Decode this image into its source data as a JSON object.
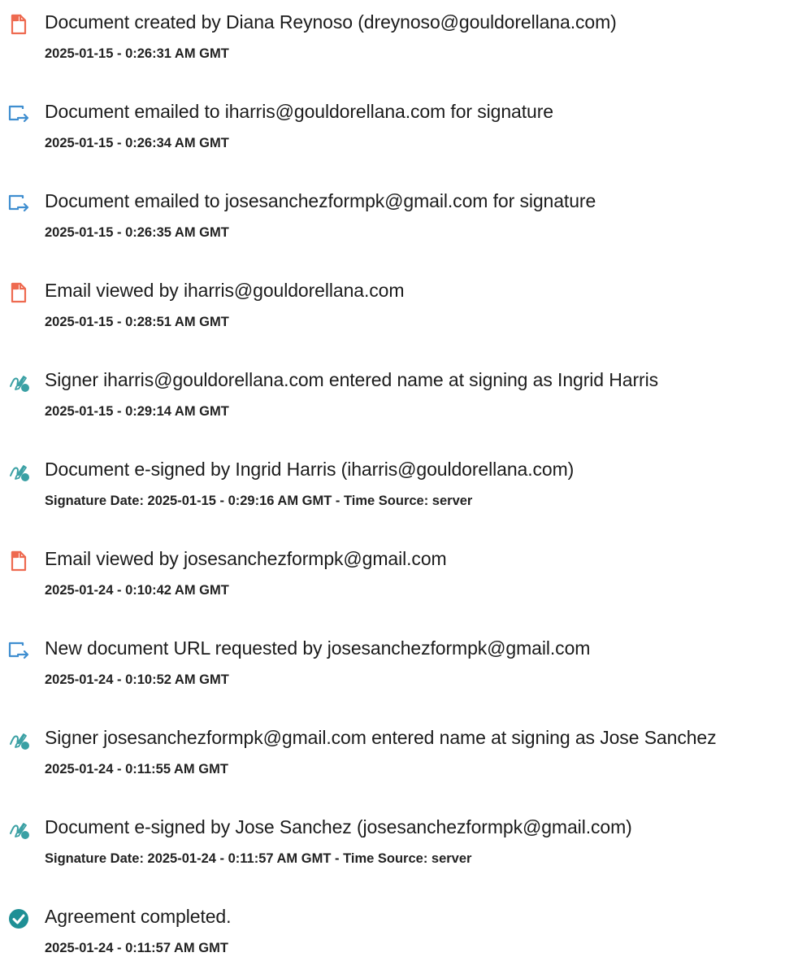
{
  "colors": {
    "doc_icon": "#ee6a50",
    "email_icon": "#3f8ed0",
    "sign_icon": "#3aa0a4",
    "complete_icon": "#1e8f95",
    "text": "#1c1c1c"
  },
  "events": [
    {
      "icon": "document-icon",
      "text": "Document created by Diana Reynoso (dreynoso@gouldorellana.com)",
      "time": "2025-01-15 - 0:26:31 AM GMT"
    },
    {
      "icon": "email-sent-icon",
      "text": "Document emailed to iharris@gouldorellana.com for signature",
      "time": "2025-01-15 - 0:26:34 AM GMT"
    },
    {
      "icon": "email-sent-icon",
      "text": "Document emailed to josesanchezformpk@gmail.com for signature",
      "time": "2025-01-15 - 0:26:35 AM GMT"
    },
    {
      "icon": "document-icon",
      "text": "Email viewed by iharris@gouldorellana.com",
      "time": "2025-01-15 - 0:28:51 AM GMT"
    },
    {
      "icon": "signature-pen-icon",
      "text": "Signer iharris@gouldorellana.com entered name at signing as Ingrid Harris",
      "time": "2025-01-15 - 0:29:14 AM GMT"
    },
    {
      "icon": "signature-pen-icon",
      "text": "Document e-signed by Ingrid Harris (iharris@gouldorellana.com)",
      "time": "Signature Date: 2025-01-15 - 0:29:16 AM GMT - Time Source: server"
    },
    {
      "icon": "document-icon",
      "text": "Email viewed by josesanchezformpk@gmail.com",
      "time": "2025-01-24 - 0:10:42 AM GMT"
    },
    {
      "icon": "email-sent-icon",
      "text": "New document URL requested by josesanchezformpk@gmail.com",
      "time": "2025-01-24 - 0:10:52 AM GMT"
    },
    {
      "icon": "signature-pen-icon",
      "text": "Signer josesanchezformpk@gmail.com entered name at signing as Jose Sanchez",
      "time": "2025-01-24 - 0:11:55 AM GMT"
    },
    {
      "icon": "signature-pen-icon",
      "text": "Document e-signed by Jose Sanchez (josesanchezformpk@gmail.com)",
      "time": "Signature Date: 2025-01-24 - 0:11:57 AM GMT - Time Source: server"
    },
    {
      "icon": "checkmark-circle-icon",
      "text": "Agreement completed.",
      "time": "2025-01-24 - 0:11:57 AM GMT"
    }
  ]
}
